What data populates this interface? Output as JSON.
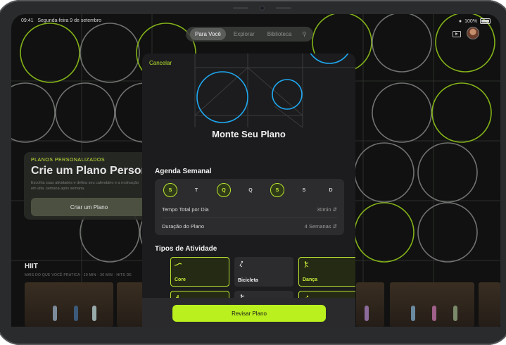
{
  "status": {
    "time": "09:41",
    "date": "Segunda-feira 9 de setembro",
    "battery": "100%"
  },
  "nav": {
    "tabs": [
      "Para Você",
      "Explorar",
      "Biblioteca"
    ]
  },
  "promo": {
    "eyebrow": "PLANOS PERSONALIZADOS",
    "title": "Crie um Plano Person",
    "description": "Escolha suas atividades e defina seu calendário e a motivação em alta, semana após semana.",
    "button": "Criar um Plano"
  },
  "hiit": {
    "title": "HIIT",
    "subtitle": "MAIS DO QUE VOCÊ PRATICA · 10 MIN - 30 MIN · HITS DE"
  },
  "sheet": {
    "cancel": "Cancelar",
    "title": "Monte Seu Plano",
    "schedule_header": "Agenda Semanal",
    "days": [
      {
        "label": "S",
        "selected": true
      },
      {
        "label": "T",
        "selected": false
      },
      {
        "label": "Q",
        "selected": true
      },
      {
        "label": "Q",
        "selected": false
      },
      {
        "label": "S",
        "selected": true
      },
      {
        "label": "S",
        "selected": false
      },
      {
        "label": "D",
        "selected": false
      }
    ],
    "daily_time_label": "Tempo Total por Dia",
    "daily_time_value": "30min",
    "duration_label": "Duração do Plano",
    "duration_value": "4 Semanas",
    "activity_header": "Tipos de Atividade",
    "activities": [
      {
        "label": "Core",
        "selected": true,
        "icon": "core-icon"
      },
      {
        "label": "Bicicleta",
        "selected": false,
        "icon": "cycling-icon"
      },
      {
        "label": "Dança",
        "selected": true,
        "icon": "dance-icon"
      },
      {
        "label": "",
        "selected": true,
        "icon": "hiit-icon"
      },
      {
        "label": "",
        "selected": false,
        "icon": "kickboxing-icon"
      },
      {
        "label": "",
        "selected": true,
        "icon": "pilates-icon"
      }
    ],
    "review_button": "Revisar Plano"
  },
  "colors": {
    "accent": "#b9f01e",
    "ring": "#8fc21a",
    "hero_circle": "#1fa8f0"
  }
}
